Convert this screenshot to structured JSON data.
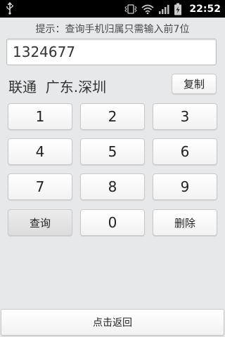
{
  "status_bar": {
    "time": "22:52",
    "icons": [
      "usb-icon",
      "vibrate-icon",
      "wifi-icon",
      "signal-icon",
      "battery-charging-icon"
    ]
  },
  "hint": "提示：查询手机归属只需输入前7位",
  "input": {
    "value": "1324677"
  },
  "result": {
    "text": "联通  广东.深圳"
  },
  "copy_label": "复制",
  "keypad": {
    "k1": "1",
    "k2": "2",
    "k3": "3",
    "k4": "4",
    "k5": "5",
    "k6": "6",
    "k7": "7",
    "k8": "8",
    "k9": "9",
    "query": "查询",
    "k0": "0",
    "delete": "删除"
  },
  "back_label": "点击返回"
}
